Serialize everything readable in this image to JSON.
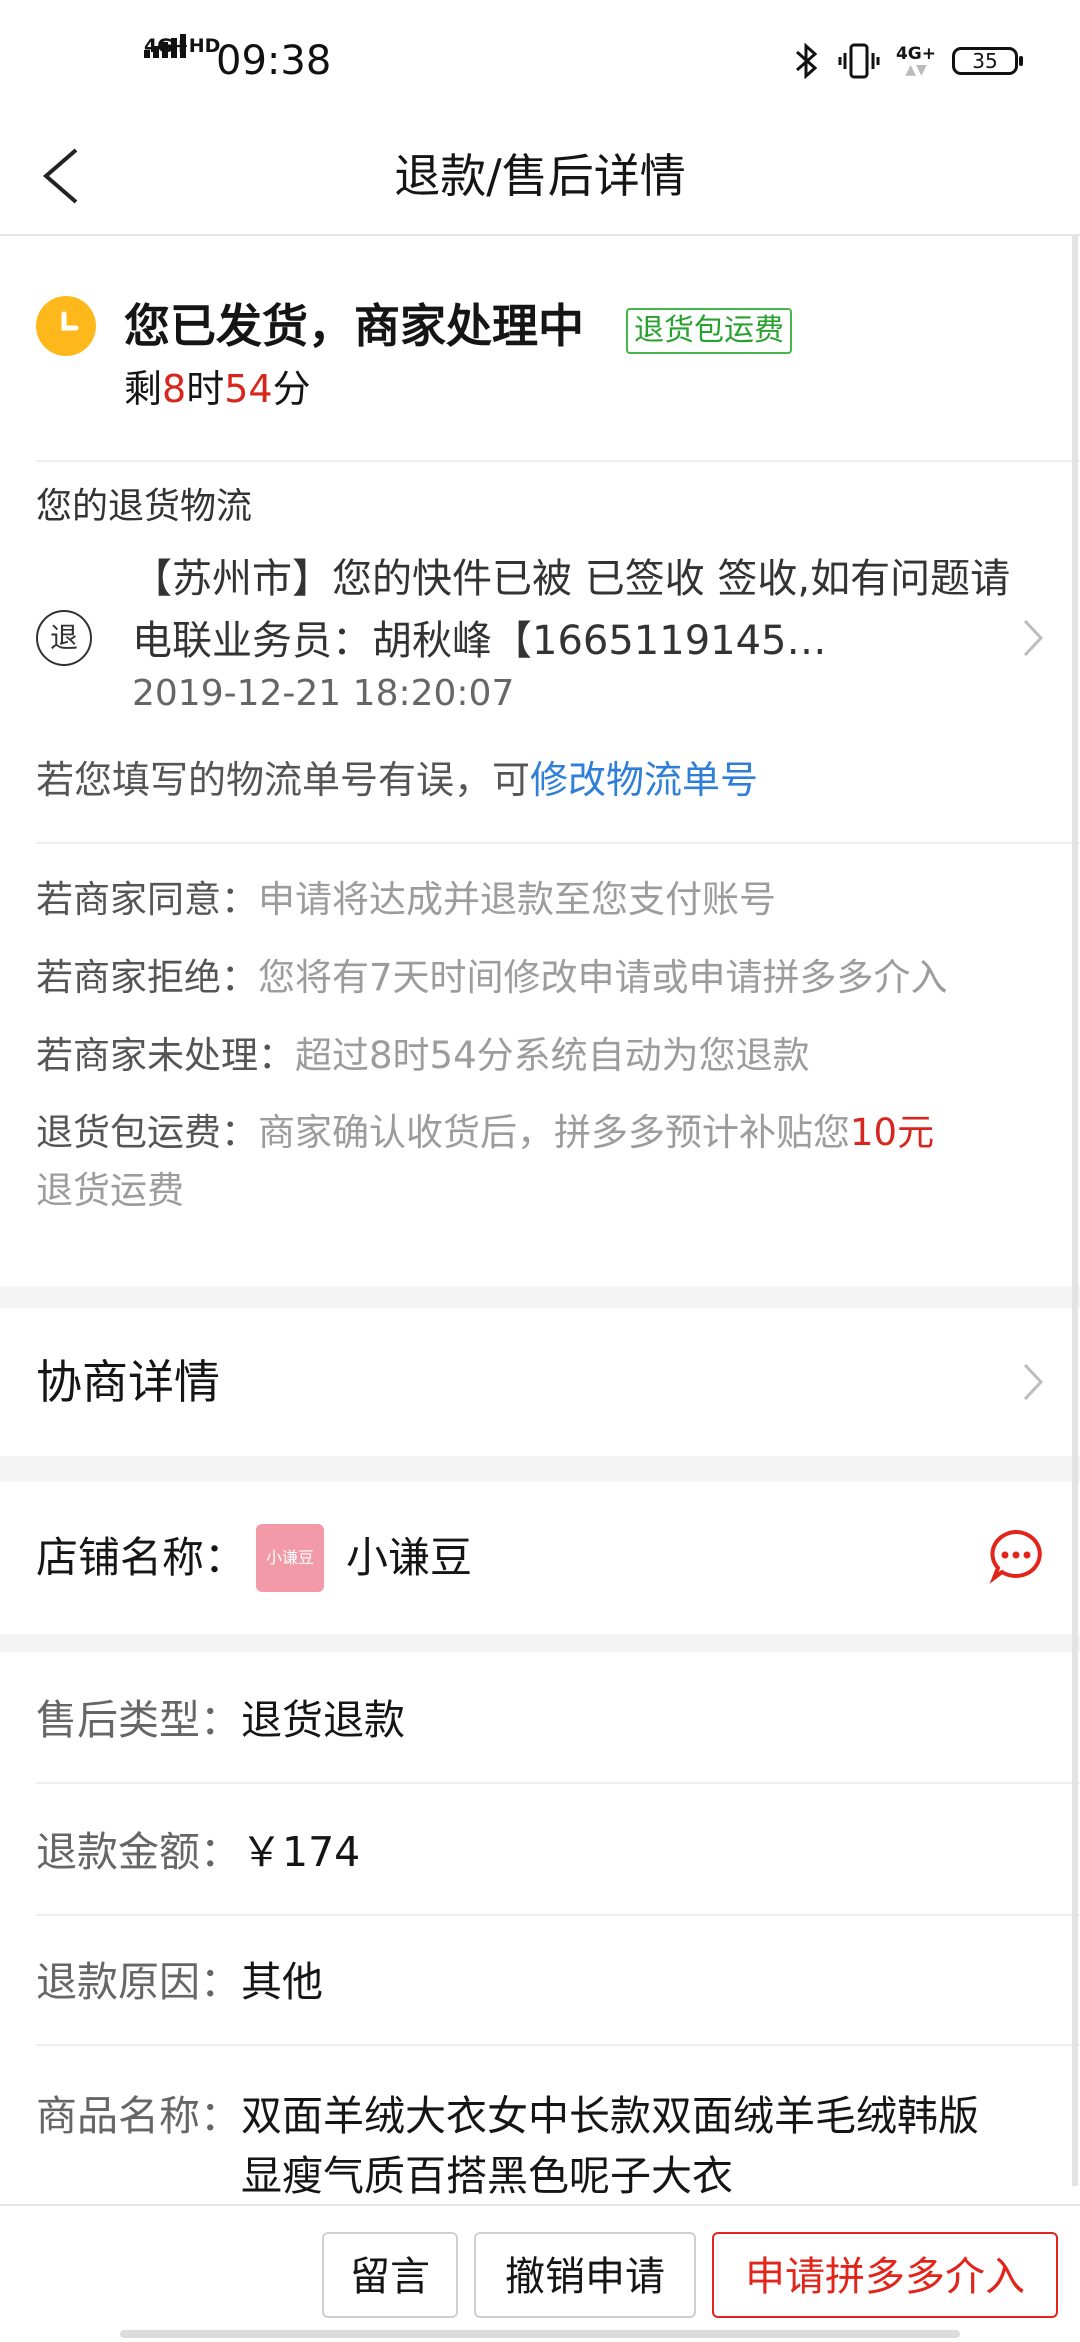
{
  "status_bar": {
    "network": "4G+HD",
    "time": "09:38",
    "network2": "4G+",
    "battery": "35"
  },
  "nav": {
    "title": "退款/售后详情"
  },
  "status": {
    "title": "您已发货，商家处理中",
    "tag": "退货包运费",
    "countdown_prefix": "剩",
    "hours": "8",
    "hours_unit": "时",
    "minutes": "54",
    "minutes_unit": "分"
  },
  "logistics": {
    "heading": "您的退货物流",
    "icon_label": "退",
    "message": "【苏州市】您的快件已被 已签收 签收,如有问题请电联业务员：胡秋峰【1665119145…",
    "time": "2019-12-21 18:20:07",
    "modify_prefix": "若您填写的物流单号有误，可",
    "modify_link": "修改物流单号"
  },
  "rules": [
    {
      "label": "若商家同意：",
      "value": "申请将达成并退款至您支付账号"
    },
    {
      "label": "若商家拒绝：",
      "value": "您将有7天时间修改申请或申请拼多多介入"
    },
    {
      "label": "若商家未处理：",
      "value": "超过8时54分系统自动为您退款"
    }
  ],
  "freight_rule": {
    "label": "退货包运费：",
    "value_before": "商家确认收货后，拼多多预计补贴您",
    "amount": "10元",
    "value_after": "退货运费"
  },
  "negotiate": {
    "label": "协商详情"
  },
  "shop": {
    "label": "店铺名称：",
    "logo_text": "小谦豆",
    "name": "小谦豆"
  },
  "info": {
    "type_label": "售后类型：",
    "type_value": "退货退款",
    "amount_label": "退款金额：",
    "amount_value": "￥174",
    "reason_label": "退款原因：",
    "reason_value": "其他",
    "product_label": "商品名称：",
    "product_line1": "双面羊绒大衣女中长款双面绒羊毛绒韩版",
    "product_line2": "显瘦气质百搭黑色呢子大衣"
  },
  "actions": {
    "message": "留言",
    "cancel": "撤销申请",
    "intervene": "申请拼多多介入"
  },
  "colors": {
    "accent_red": "#e1251b",
    "countdown_red": "#d7261e",
    "link_blue": "#2f7ed8",
    "tag_green": "#28a22e",
    "clock_yellow": "#ffb81c"
  }
}
